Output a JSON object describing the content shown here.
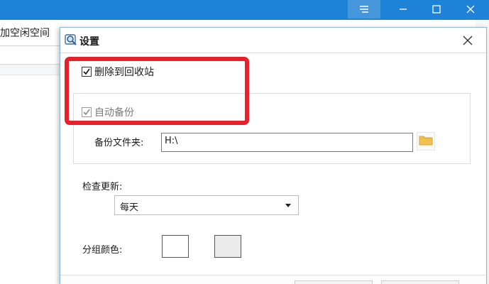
{
  "app": {
    "toolbar_text": "加空闲空间",
    "icons": [
      "menu-icon",
      "minimize-icon",
      "maximize-icon",
      "close-icon"
    ]
  },
  "dialog": {
    "title": "设置",
    "icon": "search-disk-icon",
    "delete_to_recycle": {
      "label": "删除到回收站",
      "checked": true
    },
    "auto_backup": {
      "label": "自动备份",
      "checked": true,
      "disabled": true
    },
    "backup_folder": {
      "label": "备份文件夹:",
      "value": "H:\\"
    },
    "check_update": {
      "label": "检查更新:",
      "selected": "每天"
    },
    "group_color": {
      "label": "分组颜色:",
      "colors": [
        "#ffffff",
        "#ececec"
      ]
    }
  },
  "colors": {
    "titlebar": "#1e82d6",
    "annotation": "#e8202a",
    "folder_icon": "#f2c14e"
  }
}
